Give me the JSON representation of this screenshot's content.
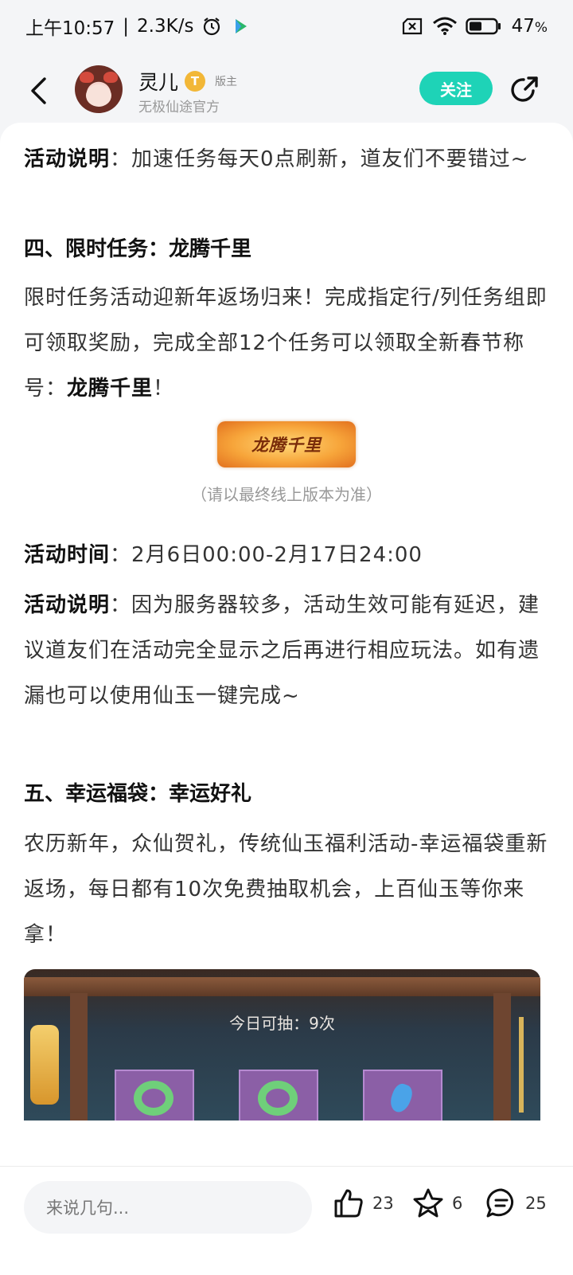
{
  "status_bar": {
    "time": "上午10:57",
    "net_speed": "2.3K/s",
    "battery": "47",
    "battery_unit": "%"
  },
  "header": {
    "user_name": "灵儿",
    "level_badge": "T",
    "role_tag": "版主",
    "user_sub": "无极仙途官方",
    "follow_label": "关注"
  },
  "content": {
    "p1_label": "活动说明",
    "p1_sep": "：",
    "p1_text": "加速任务每天0点刷新，道友们不要错过~",
    "section4_title": "四、限时任务：龙腾千里",
    "p2_text": "限时任务活动迎新年返场归来！完成指定行/列任务组即可领取奖励，完成全部12个任务可以领取全新春节称号：",
    "p2_bold": "龙腾千里",
    "p2_end": "！",
    "banner_text": "龙腾千里",
    "caption": "（请以最终线上版本为准）",
    "time_label": "活动时间",
    "time_sep": "：",
    "time_value": "2月6日00:00-2月17日24:00",
    "p3_label": "活动说明",
    "p3_sep": "：",
    "p3_text": "因为服务器较多，活动生效可能有延迟，建议道友们在活动完全显示之后再进行相应玩法。如有遗漏也可以使用仙玉一键完成~",
    "section5_title": "五、幸运福袋：幸运好礼",
    "p4_text": "农历新年，众仙贺礼，传统仙玉福利活动-幸运福袋重新返场，每日都有10次免费抽取机会，上百仙玉等你来拿！",
    "image_count_label": "今日可抽：9次"
  },
  "bottom_bar": {
    "comment_placeholder": "来说几句...",
    "likes": "23",
    "favorites": "6",
    "comments": "25"
  },
  "colors": {
    "accent": "#1ed3b7",
    "badge": "#f2b737",
    "background": "#f4f5f7"
  },
  "icons": [
    "alarm-icon",
    "app-icon",
    "sim-off-icon",
    "wifi-icon",
    "battery-icon",
    "back-arrow-icon",
    "share-icon",
    "thumbs-up-icon",
    "star-icon",
    "comment-icon"
  ]
}
